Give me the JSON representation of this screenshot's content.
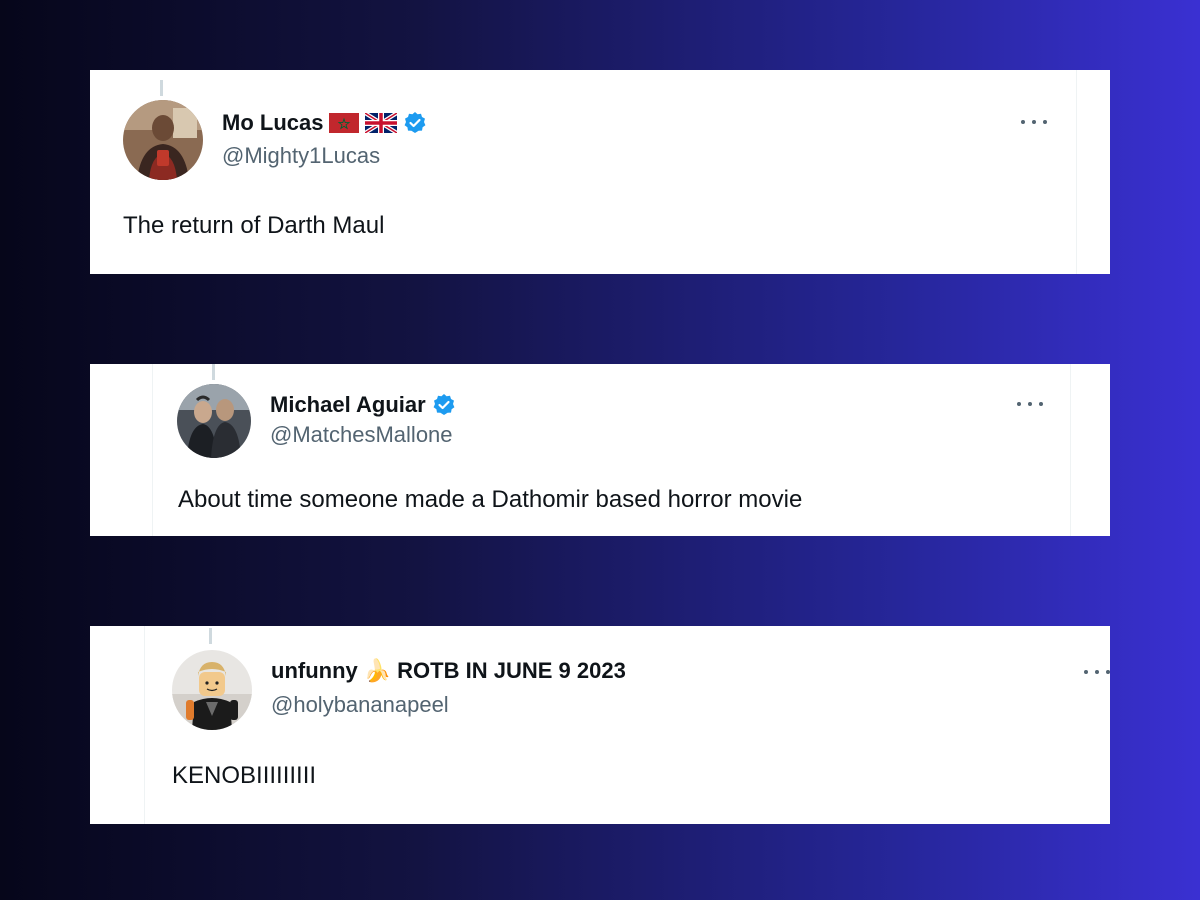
{
  "tweets": [
    {
      "display_name": "Mo Lucas",
      "handle": "@Mighty1Lucas",
      "text": "The return of Darth Maul",
      "flags": [
        "morocco-flag",
        "uk-flag"
      ],
      "verified": true,
      "avatar": "person-in-gym-selfie"
    },
    {
      "display_name": "Michael Aguiar",
      "handle": "@MatchesMallone",
      "text": "About time someone made a Dathomir based  horror movie",
      "verified": true,
      "avatar": "two-people-photo"
    },
    {
      "display_name": "unfunny",
      "name_emoji": "🍌",
      "name_suffix": "ROTB IN JUNE 9 2023",
      "handle": "@holybananapeel",
      "text": "KENOBIIIIIIIII",
      "avatar": "lego-minifigure"
    }
  ],
  "colors": {
    "background_left": "#06061a",
    "background_right": "#3a30d2",
    "card": "#ffffff",
    "name": "#0f1419",
    "handle": "#536471",
    "verified": "#1d9bf0"
  }
}
